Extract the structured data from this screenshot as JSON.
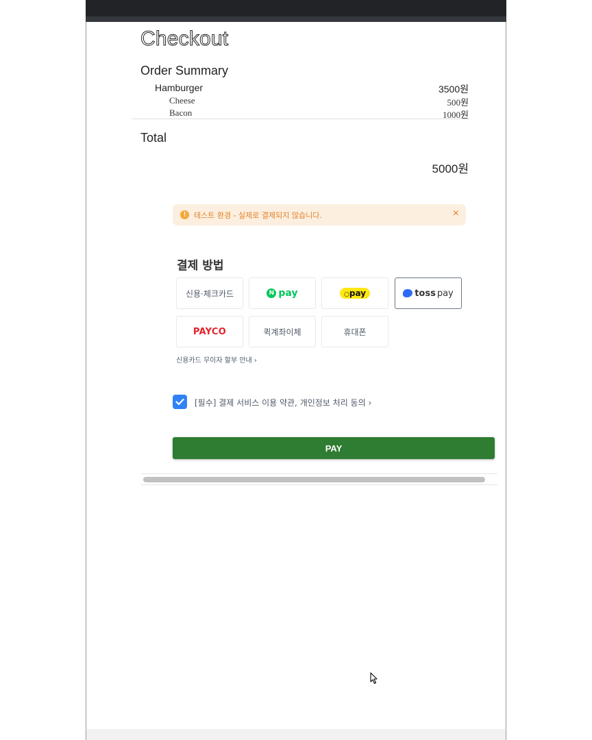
{
  "page": {
    "title": "Checkout",
    "order_summary_heading": "Order Summary",
    "items": [
      {
        "name": "Hamburger",
        "price": "3500원"
      }
    ],
    "options": [
      {
        "name": "Cheese",
        "price": "500원"
      },
      {
        "name": "Bacon",
        "price": "1000원"
      }
    ],
    "total_label": "Total",
    "total_value": "5000원"
  },
  "widget": {
    "alert": {
      "icon": "warning-icon",
      "text": "테스트 환경 - 실제로 결제되지 않습니다.",
      "close": "×"
    },
    "payment_method_title": "결제 방법",
    "methods": [
      {
        "label": "신용·체크카드"
      },
      {
        "label": "pay",
        "brand": "N"
      },
      {
        "label": "pay",
        "brand": "kakao"
      },
      {
        "label_bold": "toss",
        "label": "pay",
        "selected": true
      },
      {
        "label": "PAYCO"
      },
      {
        "label": "퀵계좌이체"
      },
      {
        "label": "휴대폰"
      }
    ],
    "installment_info": "신용카드 무이자 할부 안내 ›",
    "agreement": {
      "checked": true,
      "text": "[필수] 결제 서비스 이용 약관, 개인정보 처리 동의 ›"
    },
    "pay_button": "PAY"
  },
  "colors": {
    "pay_button": "#2e7d32",
    "checkbox": "#3182f6",
    "alert_bg": "#fcefdf",
    "alert_text": "#e3822c",
    "npay": "#03c75a",
    "kakaopay": "#ffe812",
    "payco": "#e6212a",
    "toss": "#2a6cf5"
  }
}
